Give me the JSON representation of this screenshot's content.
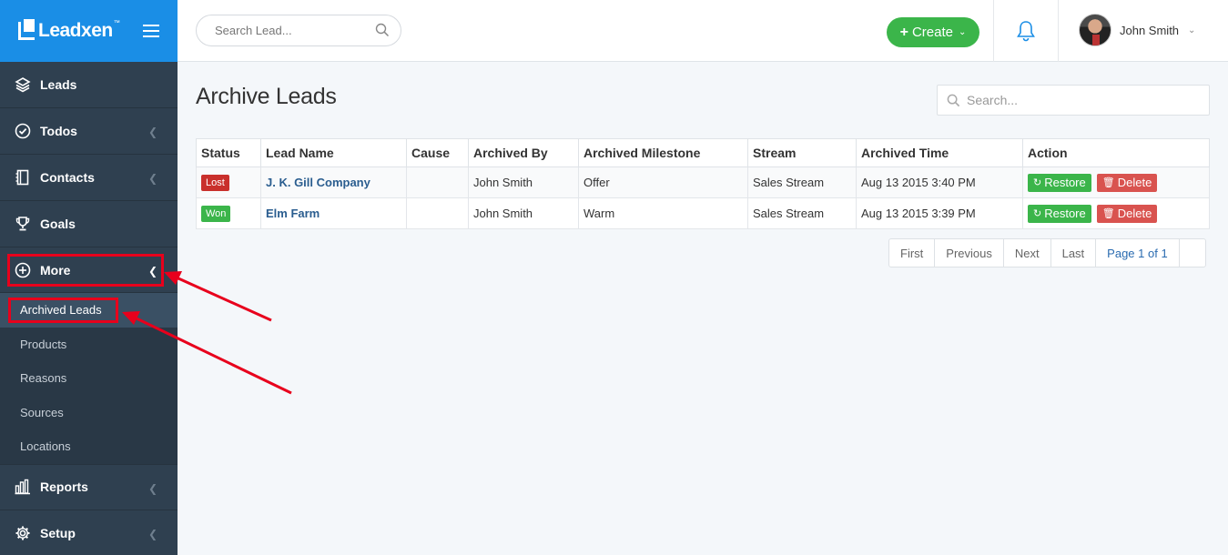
{
  "app": {
    "logo_name": "Leadxen",
    "logo_tm": "™"
  },
  "sidebar": {
    "items": [
      {
        "label": "Leads",
        "icon": "layers-icon"
      },
      {
        "label": "Todos",
        "icon": "check-circle-icon"
      },
      {
        "label": "Contacts",
        "icon": "address-book-icon"
      },
      {
        "label": "Goals",
        "icon": "trophy-icon"
      },
      {
        "label": "More",
        "icon": "plus-circle-icon"
      },
      {
        "label": "Reports",
        "icon": "bar-chart-icon"
      },
      {
        "label": "Setup",
        "icon": "gear-icon"
      }
    ],
    "more_sub": [
      {
        "label": "Archived Leads"
      },
      {
        "label": "Products"
      },
      {
        "label": "Reasons"
      },
      {
        "label": "Sources"
      },
      {
        "label": "Locations"
      }
    ]
  },
  "header": {
    "search_placeholder": "Search Lead...",
    "create_label": "Create",
    "user_name": "John Smith"
  },
  "main": {
    "title": "Archive Leads",
    "search_placeholder": "Search...",
    "columns": [
      "Status",
      "Lead Name",
      "Cause",
      "Archived By",
      "Archived Milestone",
      "Stream",
      "Archived Time",
      "Action"
    ],
    "rows": [
      {
        "status": "Lost",
        "lead_name": "J. K. Gill Company",
        "cause": "",
        "archived_by": "John Smith",
        "milestone": "Offer",
        "stream": "Sales Stream",
        "time": "Aug 13 2015 3:40 PM"
      },
      {
        "status": "Won",
        "lead_name": "Elm Farm",
        "cause": "",
        "archived_by": "John Smith",
        "milestone": "Warm",
        "stream": "Sales Stream",
        "time": "Aug 13 2015 3:39 PM"
      }
    ],
    "actions": {
      "restore": "Restore",
      "delete": "Delete"
    },
    "pager": {
      "first": "First",
      "previous": "Previous",
      "next": "Next",
      "last": "Last",
      "page": "Page 1 of 1"
    }
  },
  "colors": {
    "sidebar": "#2f4050",
    "logo_bar": "#1a8ee6",
    "success": "#3bb54a",
    "danger": "#d9534f",
    "annotation": "#e8001c"
  }
}
